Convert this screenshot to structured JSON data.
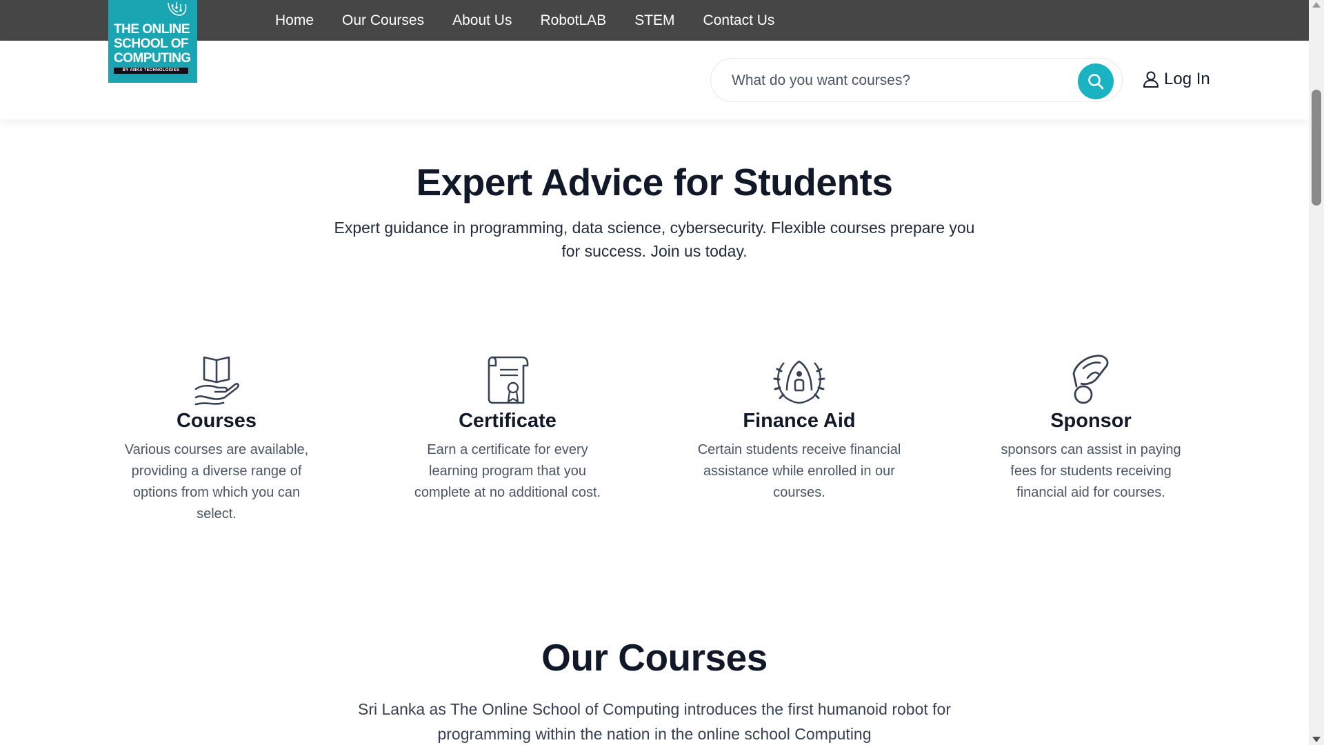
{
  "logo": {
    "line1": "THE ONLINE",
    "line2": "SCHOOL OF",
    "line3": "COMPUTING",
    "tagline": "BY ANKA TECHNOLOGIES",
    "bg_color": "#19a6b2"
  },
  "nav": {
    "items": [
      {
        "label": "Home"
      },
      {
        "label": "Our Courses"
      },
      {
        "label": "About Us"
      },
      {
        "label": "RobotLAB"
      },
      {
        "label": "STEM"
      },
      {
        "label": "Contact Us"
      }
    ],
    "bg_color": "#464646"
  },
  "search": {
    "placeholder": "What do you want courses?",
    "icon": "search-icon",
    "button_color": "#19b3c2"
  },
  "login": {
    "label": "Log In",
    "icon": "user-icon"
  },
  "hero": {
    "title": "Expert Advice for Students",
    "text": "Expert guidance in programming, data science, cybersecurity. Flexible courses prepare you for success. Join us today."
  },
  "features": [
    {
      "icon": "book-in-hand-icon",
      "title": "Courses",
      "text": "Various courses are available, providing a diverse range of options from which you can select."
    },
    {
      "icon": "certificate-scroll-icon",
      "title": "Certificate",
      "text": "Earn a certificate for every learning program that you complete at no additional cost."
    },
    {
      "icon": "laurel-people-icon",
      "title": "Finance Aid",
      "text": "Certain students receive financial assistance while enrolled in our courses."
    },
    {
      "icon": "hand-coin-icon",
      "title": "Sponsor",
      "text": "sponsors can assist in paying fees for students receiving financial aid for courses."
    }
  ],
  "courses_section": {
    "title": "Our Courses",
    "text": "Sri Lanka as The Online School of Computing introduces the first humanoid robot for programming within the nation in the online school Computing"
  }
}
